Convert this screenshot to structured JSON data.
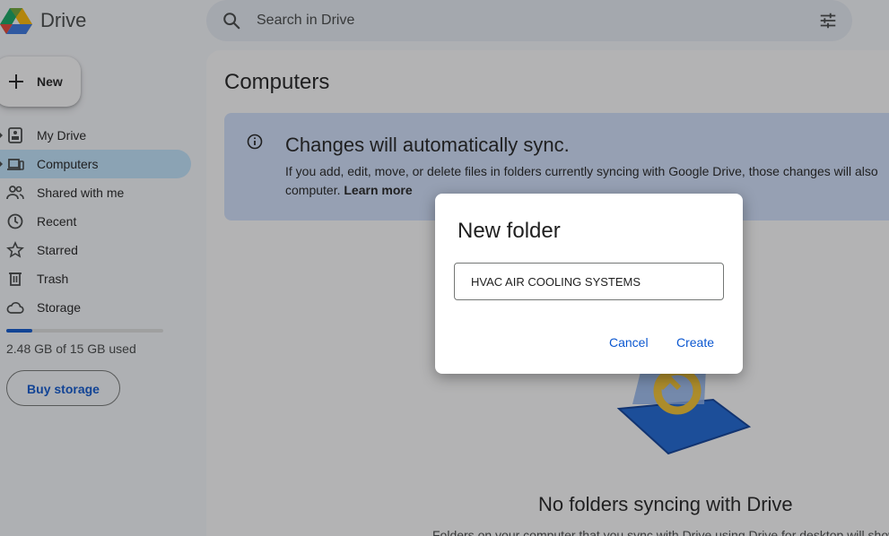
{
  "app": {
    "brand": "Drive"
  },
  "search": {
    "placeholder": "Search in Drive"
  },
  "sidebar": {
    "new_label": "New",
    "items": [
      {
        "label": "My Drive",
        "icon": "my-drive-icon"
      },
      {
        "label": "Computers",
        "icon": "computers-icon",
        "active": true
      },
      {
        "label": "Shared with me",
        "icon": "shared-icon"
      },
      {
        "label": "Recent",
        "icon": "clock-icon"
      },
      {
        "label": "Starred",
        "icon": "star-icon"
      },
      {
        "label": "Trash",
        "icon": "trash-icon"
      },
      {
        "label": "Storage",
        "icon": "cloud-icon"
      }
    ],
    "storage_text": "2.48 GB of 15 GB used",
    "storage_fraction": 0.165,
    "buy_label": "Buy storage"
  },
  "main": {
    "title": "Computers",
    "banner": {
      "title": "Changes will automatically sync.",
      "body_line1": "If you add, edit, move, or delete files in folders currently syncing with Google Drive, those changes will also",
      "body_line2": "computer.",
      "learn_more": "Learn more"
    },
    "empty_title": "No folders syncing with Drive",
    "empty_sub": "Folders on your computer that you sync with Drive using Drive for desktop will show"
  },
  "dialog": {
    "title": "New folder",
    "input_value": "HVAC AIR COOLING SYSTEMS",
    "cancel_label": "Cancel",
    "create_label": "Create"
  },
  "colors": {
    "accent": "#0b57d0",
    "active_nav": "#c2e7ff",
    "banner": "#d3e3fd"
  }
}
